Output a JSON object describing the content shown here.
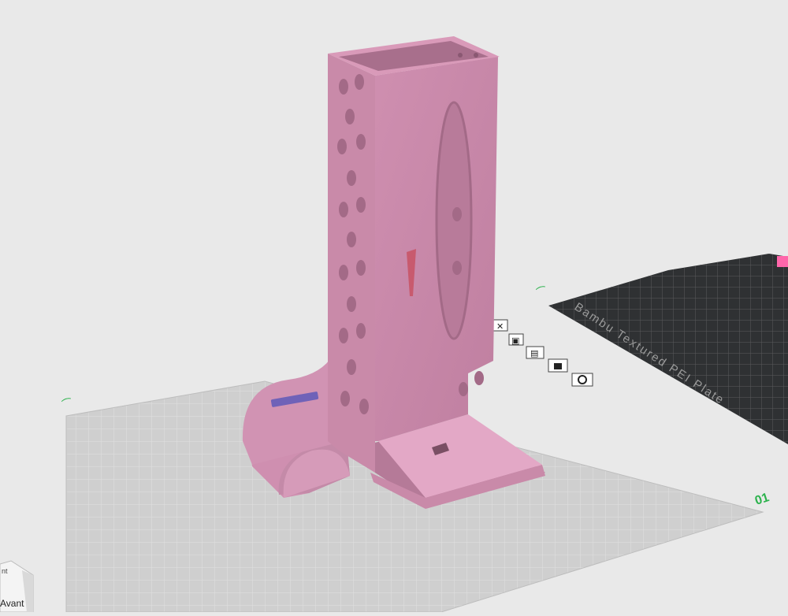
{
  "scene": {
    "active_plate_index": "01",
    "secondary_plate_label": "Bambu Textured PEI Plate",
    "view_cube_front_label": "Avant",
    "view_cube_side_label": "nt"
  },
  "plate_tools": [
    {
      "name": "delete-plate-icon",
      "glyph": "✕"
    },
    {
      "name": "auto-orient-icon",
      "glyph": "▣"
    },
    {
      "name": "arrange-icon",
      "glyph": "▤"
    },
    {
      "name": "lock-plate-icon",
      "glyph": "🔒"
    },
    {
      "name": "plate-settings-icon",
      "glyph": "⚙"
    }
  ],
  "colors": {
    "background": "#e9e9e9",
    "plate": "#cfcfcf",
    "plate_grid": "#e4e4e4",
    "dark_plate": "#2f3133",
    "model_front": "#d99ab9",
    "model_side": "#c98aa9",
    "model_shadow": "#b37795",
    "highlight": "#ff66aa",
    "plate_index_color": "#2bb24c"
  }
}
